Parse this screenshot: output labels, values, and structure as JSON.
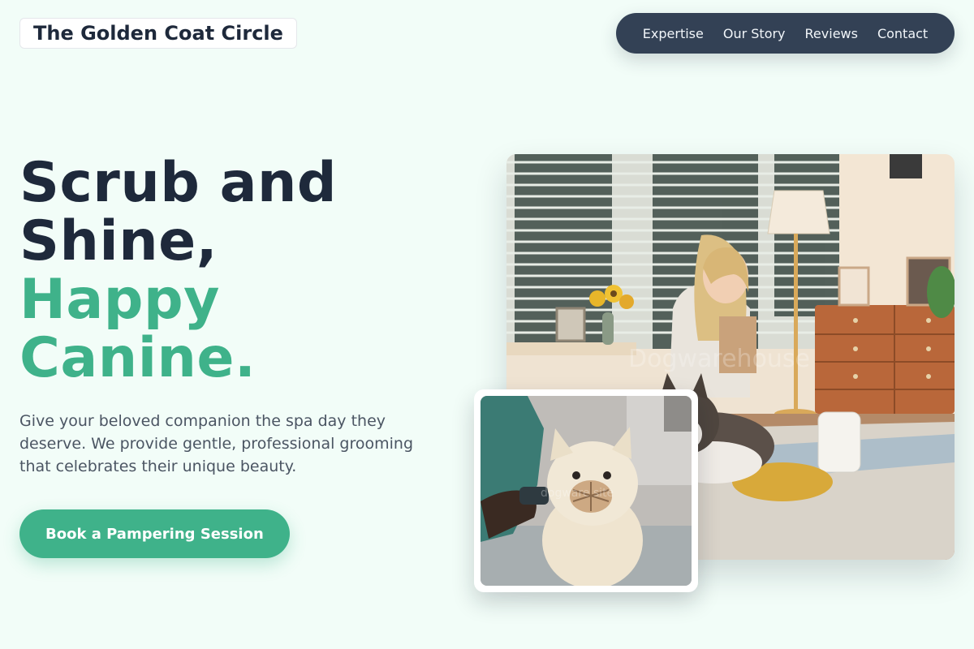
{
  "brand": {
    "name": "The Golden Coat Circle"
  },
  "nav": {
    "items": [
      {
        "label": "Expertise"
      },
      {
        "label": "Our Story"
      },
      {
        "label": "Reviews"
      },
      {
        "label": "Contact"
      }
    ]
  },
  "hero": {
    "headline_line1": "Scrub and",
    "headline_line2": "Shine,",
    "headline_line3": "Happy",
    "headline_line4": "Canine.",
    "description": "Give your beloved companion the spa day they deserve. We provide gentle, professional grooming that celebrates their unique beauty.",
    "cta_label": "Book a Pampering Session"
  },
  "colors": {
    "background": "#f2fdf8",
    "accent": "#3fb28a",
    "dark": "#1e293b",
    "nav_bg": "#334155"
  }
}
